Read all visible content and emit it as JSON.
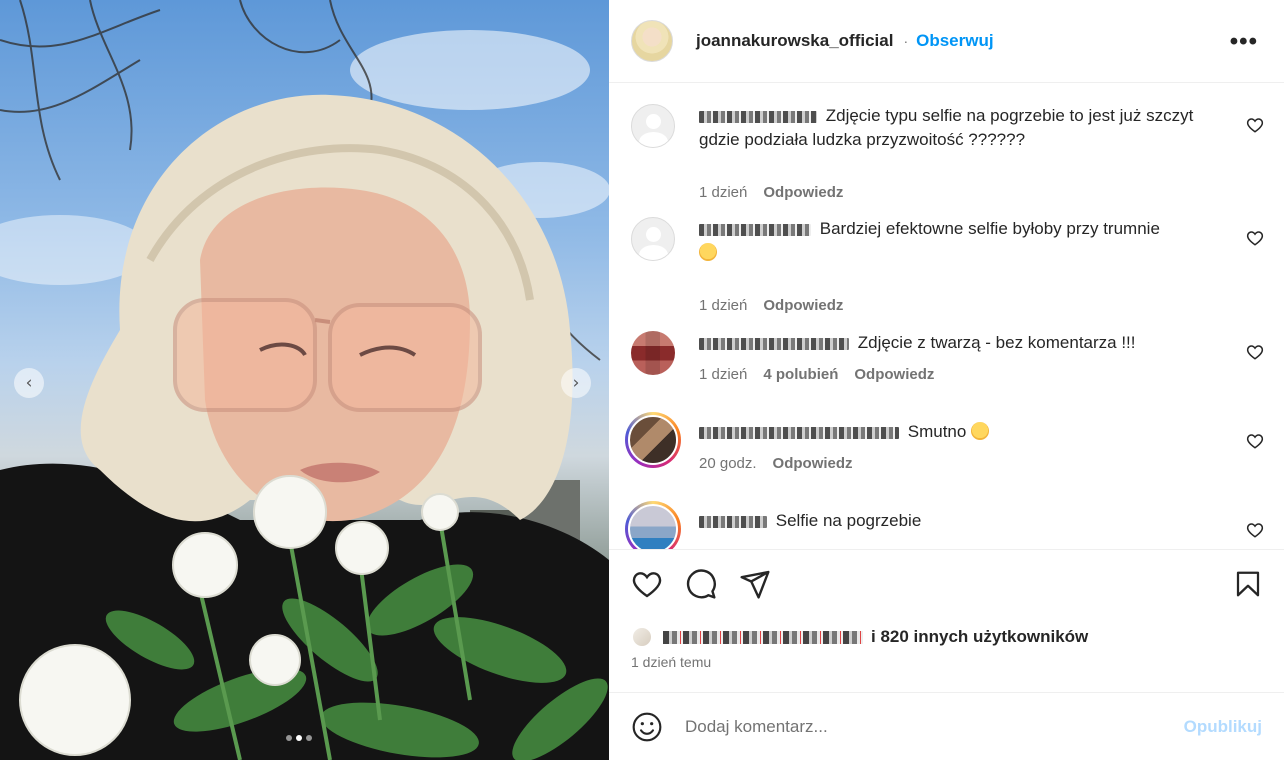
{
  "post": {
    "username": "joannakurowska_official",
    "separator": "·",
    "follow_label": "Obserwuj",
    "more_label": "•••",
    "carousel": {
      "prev_glyph": "‹",
      "next_glyph": "›",
      "slide_count": 3,
      "active_slide": 2
    }
  },
  "comments": [
    {
      "text": "Zdjęcie typu selfie na pogrzebie to jest już szczyt gdzie podziała ludzka przyzwoitość ??????",
      "time": "1 dzień",
      "likes": "",
      "reply": "Odpowiedz",
      "avatar": "default-avatar"
    },
    {
      "text": "Bardziej efektowne selfie byłoby przy trumnie",
      "time": "1 dzień",
      "likes": "",
      "reply": "Odpowiedz",
      "avatar": "default-avatar",
      "emoji": "laughing-emoji"
    },
    {
      "text": "Zdjęcie z twarzą - bez komentarza !!!",
      "time": "1 dzień",
      "likes": "4 polubień",
      "reply": "Odpowiedz",
      "avatar": "pixelated-avatar"
    },
    {
      "text": "Smutno",
      "time": "20 godz.",
      "likes": "",
      "reply": "Odpowiedz",
      "avatar": "story-ring-avatar",
      "emoji": "flushed-emoji"
    },
    {
      "text": "Selfie na pogrzebie",
      "time": "",
      "likes": "",
      "reply": "",
      "avatar": "story-ring-avatar"
    }
  ],
  "engagement": {
    "likes_text": "i 820 innych użytkowników",
    "posted_time": "1 dzień temu"
  },
  "composer": {
    "placeholder": "Dodaj komentarz...",
    "publish_label": "Opublikuj"
  },
  "colors": {
    "accent": "#0095f6",
    "publish_disabled": "#b3dbff",
    "secondary_text": "#737373",
    "primary_text": "#262626"
  }
}
